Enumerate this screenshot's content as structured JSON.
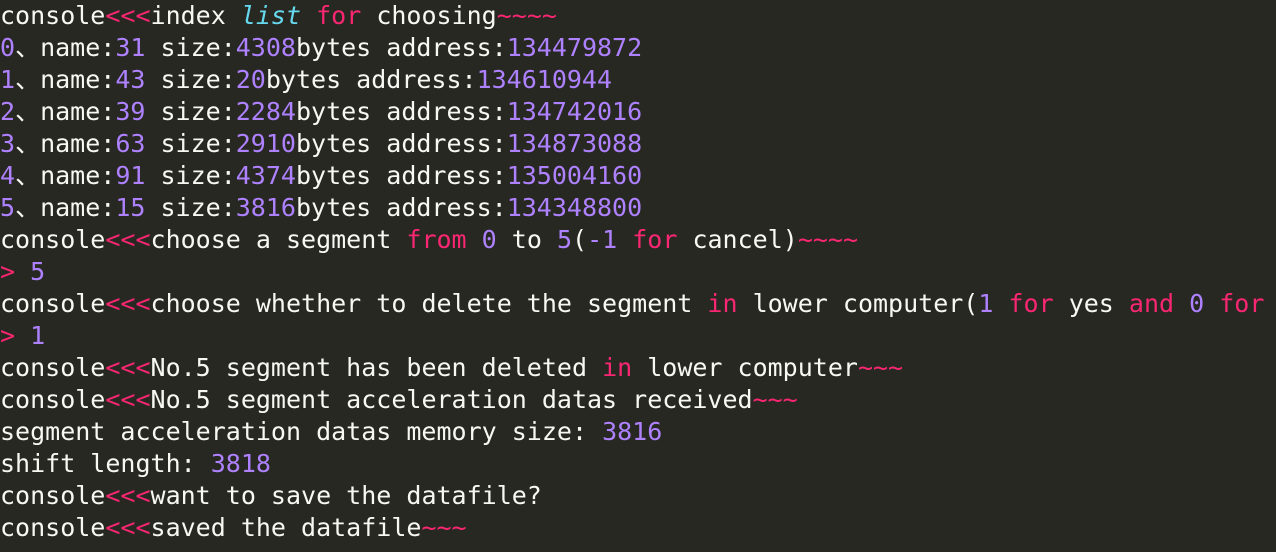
{
  "colors": {
    "background": "#272822",
    "default_text": "#f8f8f2",
    "number": "#ae81ff",
    "keyword": "#f92672",
    "builtin_italic": "#66d9ef"
  },
  "lines": [
    [
      {
        "t": "console",
        "c": "w"
      },
      {
        "t": "<<<",
        "c": "k"
      },
      {
        "t": "index ",
        "c": "w"
      },
      {
        "t": "list",
        "c": "c"
      },
      {
        "t": " ",
        "c": "w"
      },
      {
        "t": "for",
        "c": "k"
      },
      {
        "t": " choosing",
        "c": "w"
      },
      {
        "t": "~~~~",
        "c": "k"
      }
    ],
    [
      {
        "t": "0",
        "c": "n"
      },
      {
        "t": "、name:",
        "c": "w"
      },
      {
        "t": "31",
        "c": "n"
      },
      {
        "t": " size:",
        "c": "w"
      },
      {
        "t": "4308",
        "c": "n"
      },
      {
        "t": "bytes address:",
        "c": "w"
      },
      {
        "t": "134479872",
        "c": "n"
      }
    ],
    [
      {
        "t": "1",
        "c": "n"
      },
      {
        "t": "、name:",
        "c": "w"
      },
      {
        "t": "43",
        "c": "n"
      },
      {
        "t": " size:",
        "c": "w"
      },
      {
        "t": "20",
        "c": "n"
      },
      {
        "t": "bytes address:",
        "c": "w"
      },
      {
        "t": "134610944",
        "c": "n"
      }
    ],
    [
      {
        "t": "2",
        "c": "n"
      },
      {
        "t": "、name:",
        "c": "w"
      },
      {
        "t": "39",
        "c": "n"
      },
      {
        "t": " size:",
        "c": "w"
      },
      {
        "t": "2284",
        "c": "n"
      },
      {
        "t": "bytes address:",
        "c": "w"
      },
      {
        "t": "134742016",
        "c": "n"
      }
    ],
    [
      {
        "t": "3",
        "c": "n"
      },
      {
        "t": "、name:",
        "c": "w"
      },
      {
        "t": "63",
        "c": "n"
      },
      {
        "t": " size:",
        "c": "w"
      },
      {
        "t": "2910",
        "c": "n"
      },
      {
        "t": "bytes address:",
        "c": "w"
      },
      {
        "t": "134873088",
        "c": "n"
      }
    ],
    [
      {
        "t": "4",
        "c": "n"
      },
      {
        "t": "、name:",
        "c": "w"
      },
      {
        "t": "91",
        "c": "n"
      },
      {
        "t": " size:",
        "c": "w"
      },
      {
        "t": "4374",
        "c": "n"
      },
      {
        "t": "bytes address:",
        "c": "w"
      },
      {
        "t": "135004160",
        "c": "n"
      }
    ],
    [
      {
        "t": "5",
        "c": "n"
      },
      {
        "t": "、name:",
        "c": "w"
      },
      {
        "t": "15",
        "c": "n"
      },
      {
        "t": " size:",
        "c": "w"
      },
      {
        "t": "3816",
        "c": "n"
      },
      {
        "t": "bytes address:",
        "c": "w"
      },
      {
        "t": "134348800",
        "c": "n"
      }
    ],
    [
      {
        "t": "console",
        "c": "w"
      },
      {
        "t": "<<<",
        "c": "k"
      },
      {
        "t": "choose a segment ",
        "c": "w"
      },
      {
        "t": "from",
        "c": "k"
      },
      {
        "t": " ",
        "c": "w"
      },
      {
        "t": "0",
        "c": "n"
      },
      {
        "t": " to ",
        "c": "w"
      },
      {
        "t": "5",
        "c": "n"
      },
      {
        "t": "(",
        "c": "w"
      },
      {
        "t": "-1",
        "c": "n"
      },
      {
        "t": " ",
        "c": "w"
      },
      {
        "t": "for",
        "c": "k"
      },
      {
        "t": " cancel)",
        "c": "w"
      },
      {
        "t": "~~~~",
        "c": "k"
      }
    ],
    [
      {
        "t": ">",
        "c": "k"
      },
      {
        "t": " ",
        "c": "w"
      },
      {
        "t": "5",
        "c": "n"
      }
    ],
    [
      {
        "t": "console",
        "c": "w"
      },
      {
        "t": "<<<",
        "c": "k"
      },
      {
        "t": "choose whether to delete the segment ",
        "c": "w"
      },
      {
        "t": "in",
        "c": "k"
      },
      {
        "t": " lower computer(",
        "c": "w"
      },
      {
        "t": "1",
        "c": "n"
      },
      {
        "t": " ",
        "c": "w"
      },
      {
        "t": "for",
        "c": "k"
      },
      {
        "t": " yes ",
        "c": "w"
      },
      {
        "t": "and",
        "c": "k"
      },
      {
        "t": " ",
        "c": "w"
      },
      {
        "t": "0",
        "c": "n"
      },
      {
        "t": " ",
        "c": "w"
      },
      {
        "t": "for",
        "c": "k"
      }
    ],
    [
      {
        "t": ">",
        "c": "k"
      },
      {
        "t": " ",
        "c": "w"
      },
      {
        "t": "1",
        "c": "n"
      }
    ],
    [
      {
        "t": "console",
        "c": "w"
      },
      {
        "t": "<<<",
        "c": "k"
      },
      {
        "t": "No.5 segment has been deleted ",
        "c": "w"
      },
      {
        "t": "in",
        "c": "k"
      },
      {
        "t": " lower computer",
        "c": "w"
      },
      {
        "t": "~~~",
        "c": "k"
      }
    ],
    [
      {
        "t": "console",
        "c": "w"
      },
      {
        "t": "<<<",
        "c": "k"
      },
      {
        "t": "No.5 segment acceleration datas received",
        "c": "w"
      },
      {
        "t": "~~~",
        "c": "k"
      }
    ],
    [
      {
        "t": "segment acceleration datas memory size: ",
        "c": "w"
      },
      {
        "t": "3816",
        "c": "n"
      }
    ],
    [
      {
        "t": "shift length: ",
        "c": "w"
      },
      {
        "t": "3818",
        "c": "n"
      }
    ],
    [
      {
        "t": "console",
        "c": "w"
      },
      {
        "t": "<<<",
        "c": "k"
      },
      {
        "t": "want to save the datafile?",
        "c": "w"
      }
    ],
    [
      {
        "t": "console",
        "c": "w"
      },
      {
        "t": "<<<",
        "c": "k"
      },
      {
        "t": "saved the datafile",
        "c": "w"
      },
      {
        "t": "~~~",
        "c": "k"
      }
    ]
  ]
}
